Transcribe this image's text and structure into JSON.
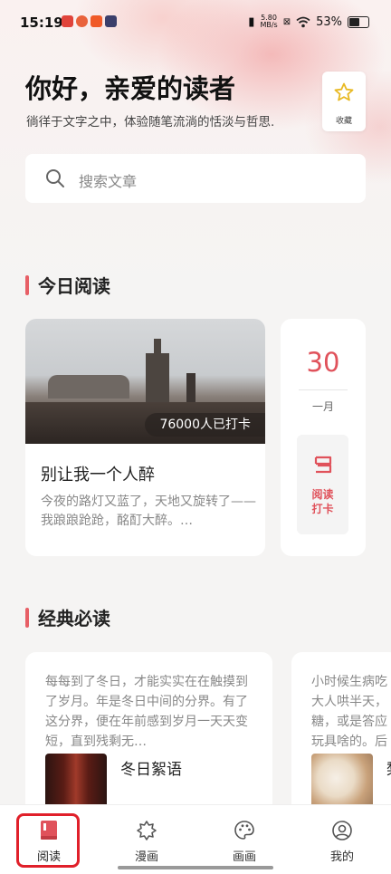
{
  "status_bar": {
    "time": "15:19",
    "speed_value": "5.80",
    "speed_unit": "MB/s",
    "battery": "53%"
  },
  "header": {
    "greeting": "你好，亲爱的读者",
    "subtitle": "徜徉于文字之中，体验随笔流淌的恬淡与哲思.",
    "favorites_label": "收藏"
  },
  "search": {
    "placeholder": "搜索文章"
  },
  "today": {
    "section_title": "今日阅读",
    "article": {
      "checkins_badge": "76000人已打卡",
      "title": "别让我一个人醉",
      "excerpt": "今夜的路灯又蓝了，天地又旋转了——我踉踉跄跄，酩酊大醉。…"
    },
    "date": {
      "day": "30",
      "month": "一月",
      "checkin_line1": "阅读",
      "checkin_line2": "打卡"
    }
  },
  "classics": {
    "section_title": "经典必读",
    "items": [
      {
        "excerpt": "每每到了冬日，才能实实在在触摸到了岁月。年是冬日中间的分界。有了这分界，便在年前感到岁月一天天变短，直到残剩无…",
        "title": "冬日絮语"
      },
      {
        "excerpt_lines": [
          "小时候生病吃",
          "大人哄半天，",
          "糖，或是答应",
          "玩具啥的。后"
        ],
        "title": "梨"
      }
    ]
  },
  "tabbar": {
    "tabs": [
      {
        "label": "阅读",
        "active": true
      },
      {
        "label": "漫画",
        "active": false
      },
      {
        "label": "画画",
        "active": false
      },
      {
        "label": "我的",
        "active": false
      }
    ]
  },
  "colors": {
    "accent": "#e0525b",
    "highlight_box": "#e0202a"
  }
}
